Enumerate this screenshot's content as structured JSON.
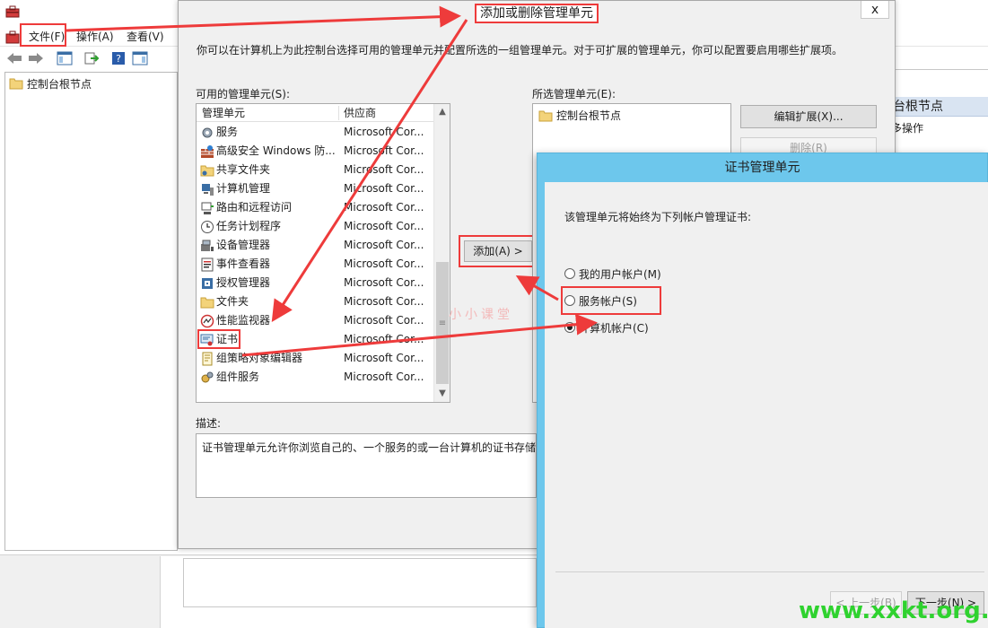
{
  "mmc": {
    "menu": {
      "file": "文件(F)",
      "action": "操作(A)",
      "view": "查看(V)"
    },
    "tree_root": "控制台根节点",
    "actions_header": "台根节点",
    "actions_more": "多操作"
  },
  "dialog": {
    "title": "添加或删除管理单元",
    "close": "x",
    "intro": "你可以在计算机上为此控制台选择可用的管理单元并配置所选的一组管理单元。对于可扩展的管理单元，你可以配置要启用哪些扩展项。",
    "available_label": "可用的管理单元(S):",
    "selected_label": "所选管理单元(E):",
    "col_snapin": "管理单元",
    "col_vendor": "供应商",
    "snapins": [
      {
        "name": "服务",
        "vendor": "Microsoft Cor...",
        "icon": "gear-icon"
      },
      {
        "name": "高级安全 Windows 防...",
        "vendor": "Microsoft Cor...",
        "icon": "firewall-icon"
      },
      {
        "name": "共享文件夹",
        "vendor": "Microsoft Cor...",
        "icon": "shared-folder-icon"
      },
      {
        "name": "计算机管理",
        "vendor": "Microsoft Cor...",
        "icon": "computer-management-icon"
      },
      {
        "name": "路由和远程访问",
        "vendor": "Microsoft Cor...",
        "icon": "routing-icon"
      },
      {
        "name": "任务计划程序",
        "vendor": "Microsoft Cor...",
        "icon": "clock-icon"
      },
      {
        "name": "设备管理器",
        "vendor": "Microsoft Cor...",
        "icon": "device-manager-icon"
      },
      {
        "name": "事件查看器",
        "vendor": "Microsoft Cor...",
        "icon": "event-viewer-icon"
      },
      {
        "name": "授权管理器",
        "vendor": "Microsoft Cor...",
        "icon": "authorization-icon"
      },
      {
        "name": "文件夹",
        "vendor": "Microsoft Cor...",
        "icon": "folder-icon"
      },
      {
        "name": "性能监视器",
        "vendor": "Microsoft Cor...",
        "icon": "performance-icon"
      },
      {
        "name": "证书",
        "vendor": "Microsoft Cor...",
        "icon": "certificate-icon"
      },
      {
        "name": "组策略对象编辑器",
        "vendor": "Microsoft Cor...",
        "icon": "policy-icon"
      },
      {
        "name": "组件服务",
        "vendor": "Microsoft Cor...",
        "icon": "component-services-icon"
      }
    ],
    "add_button": "添加(A) >",
    "selected_root": "控制台根节点",
    "edit_extensions_button": "编辑扩展(X)...",
    "remove_button": "删除(R)",
    "description_label": "描述:",
    "description": "证书管理单元允许你浏览自己的、一个服务的或一台计算机的证书存储的"
  },
  "cert_dialog": {
    "title": "证书管理单元",
    "intro": "该管理单元将始终为下列帐户管理证书:",
    "options": [
      {
        "label": "我的用户帐户(M)",
        "checked": false
      },
      {
        "label": "服务帐户(S)",
        "checked": false
      },
      {
        "label": "计算机帐户(C)",
        "checked": true
      }
    ],
    "prev_button": "< 上一步(B)",
    "next_button": "下一步(N) >"
  },
  "watermark": "小小课堂",
  "site_mark": "www.xxkt.org.cn",
  "colors": {
    "annotation": "#ee3b3b",
    "cert_titlebar": "#6dc7ec",
    "site_mark": "#2fd22f"
  }
}
